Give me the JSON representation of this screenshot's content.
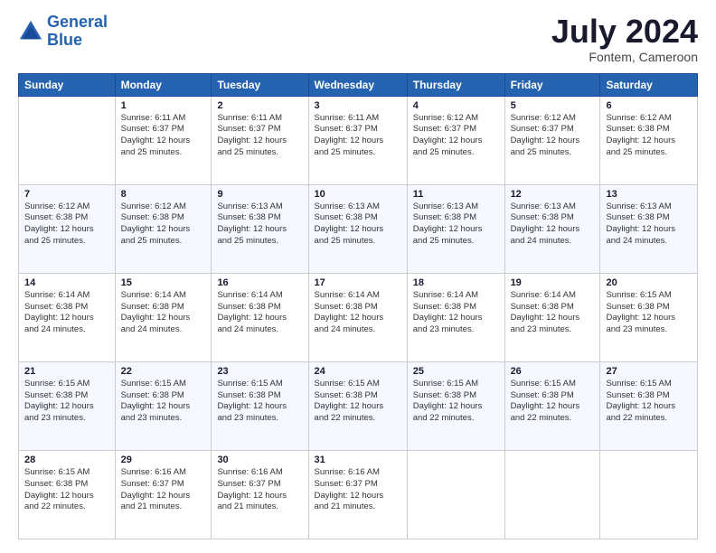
{
  "header": {
    "logo_line1": "General",
    "logo_line2": "Blue",
    "month": "July 2024",
    "location": "Fontem, Cameroon"
  },
  "weekdays": [
    "Sunday",
    "Monday",
    "Tuesday",
    "Wednesday",
    "Thursday",
    "Friday",
    "Saturday"
  ],
  "weeks": [
    [
      {
        "day": "",
        "info": ""
      },
      {
        "day": "1",
        "info": "Sunrise: 6:11 AM\nSunset: 6:37 PM\nDaylight: 12 hours\nand 25 minutes."
      },
      {
        "day": "2",
        "info": "Sunrise: 6:11 AM\nSunset: 6:37 PM\nDaylight: 12 hours\nand 25 minutes."
      },
      {
        "day": "3",
        "info": "Sunrise: 6:11 AM\nSunset: 6:37 PM\nDaylight: 12 hours\nand 25 minutes."
      },
      {
        "day": "4",
        "info": "Sunrise: 6:12 AM\nSunset: 6:37 PM\nDaylight: 12 hours\nand 25 minutes."
      },
      {
        "day": "5",
        "info": "Sunrise: 6:12 AM\nSunset: 6:37 PM\nDaylight: 12 hours\nand 25 minutes."
      },
      {
        "day": "6",
        "info": "Sunrise: 6:12 AM\nSunset: 6:38 PM\nDaylight: 12 hours\nand 25 minutes."
      }
    ],
    [
      {
        "day": "7",
        "info": "Sunrise: 6:12 AM\nSunset: 6:38 PM\nDaylight: 12 hours\nand 25 minutes."
      },
      {
        "day": "8",
        "info": "Sunrise: 6:12 AM\nSunset: 6:38 PM\nDaylight: 12 hours\nand 25 minutes."
      },
      {
        "day": "9",
        "info": "Sunrise: 6:13 AM\nSunset: 6:38 PM\nDaylight: 12 hours\nand 25 minutes."
      },
      {
        "day": "10",
        "info": "Sunrise: 6:13 AM\nSunset: 6:38 PM\nDaylight: 12 hours\nand 25 minutes."
      },
      {
        "day": "11",
        "info": "Sunrise: 6:13 AM\nSunset: 6:38 PM\nDaylight: 12 hours\nand 25 minutes."
      },
      {
        "day": "12",
        "info": "Sunrise: 6:13 AM\nSunset: 6:38 PM\nDaylight: 12 hours\nand 24 minutes."
      },
      {
        "day": "13",
        "info": "Sunrise: 6:13 AM\nSunset: 6:38 PM\nDaylight: 12 hours\nand 24 minutes."
      }
    ],
    [
      {
        "day": "14",
        "info": "Sunrise: 6:14 AM\nSunset: 6:38 PM\nDaylight: 12 hours\nand 24 minutes."
      },
      {
        "day": "15",
        "info": "Sunrise: 6:14 AM\nSunset: 6:38 PM\nDaylight: 12 hours\nand 24 minutes."
      },
      {
        "day": "16",
        "info": "Sunrise: 6:14 AM\nSunset: 6:38 PM\nDaylight: 12 hours\nand 24 minutes."
      },
      {
        "day": "17",
        "info": "Sunrise: 6:14 AM\nSunset: 6:38 PM\nDaylight: 12 hours\nand 24 minutes."
      },
      {
        "day": "18",
        "info": "Sunrise: 6:14 AM\nSunset: 6:38 PM\nDaylight: 12 hours\nand 23 minutes."
      },
      {
        "day": "19",
        "info": "Sunrise: 6:14 AM\nSunset: 6:38 PM\nDaylight: 12 hours\nand 23 minutes."
      },
      {
        "day": "20",
        "info": "Sunrise: 6:15 AM\nSunset: 6:38 PM\nDaylight: 12 hours\nand 23 minutes."
      }
    ],
    [
      {
        "day": "21",
        "info": "Sunrise: 6:15 AM\nSunset: 6:38 PM\nDaylight: 12 hours\nand 23 minutes."
      },
      {
        "day": "22",
        "info": "Sunrise: 6:15 AM\nSunset: 6:38 PM\nDaylight: 12 hours\nand 23 minutes."
      },
      {
        "day": "23",
        "info": "Sunrise: 6:15 AM\nSunset: 6:38 PM\nDaylight: 12 hours\nand 23 minutes."
      },
      {
        "day": "24",
        "info": "Sunrise: 6:15 AM\nSunset: 6:38 PM\nDaylight: 12 hours\nand 22 minutes."
      },
      {
        "day": "25",
        "info": "Sunrise: 6:15 AM\nSunset: 6:38 PM\nDaylight: 12 hours\nand 22 minutes."
      },
      {
        "day": "26",
        "info": "Sunrise: 6:15 AM\nSunset: 6:38 PM\nDaylight: 12 hours\nand 22 minutes."
      },
      {
        "day": "27",
        "info": "Sunrise: 6:15 AM\nSunset: 6:38 PM\nDaylight: 12 hours\nand 22 minutes."
      }
    ],
    [
      {
        "day": "28",
        "info": "Sunrise: 6:15 AM\nSunset: 6:38 PM\nDaylight: 12 hours\nand 22 minutes."
      },
      {
        "day": "29",
        "info": "Sunrise: 6:16 AM\nSunset: 6:37 PM\nDaylight: 12 hours\nand 21 minutes."
      },
      {
        "day": "30",
        "info": "Sunrise: 6:16 AM\nSunset: 6:37 PM\nDaylight: 12 hours\nand 21 minutes."
      },
      {
        "day": "31",
        "info": "Sunrise: 6:16 AM\nSunset: 6:37 PM\nDaylight: 12 hours\nand 21 minutes."
      },
      {
        "day": "",
        "info": ""
      },
      {
        "day": "",
        "info": ""
      },
      {
        "day": "",
        "info": ""
      }
    ]
  ]
}
